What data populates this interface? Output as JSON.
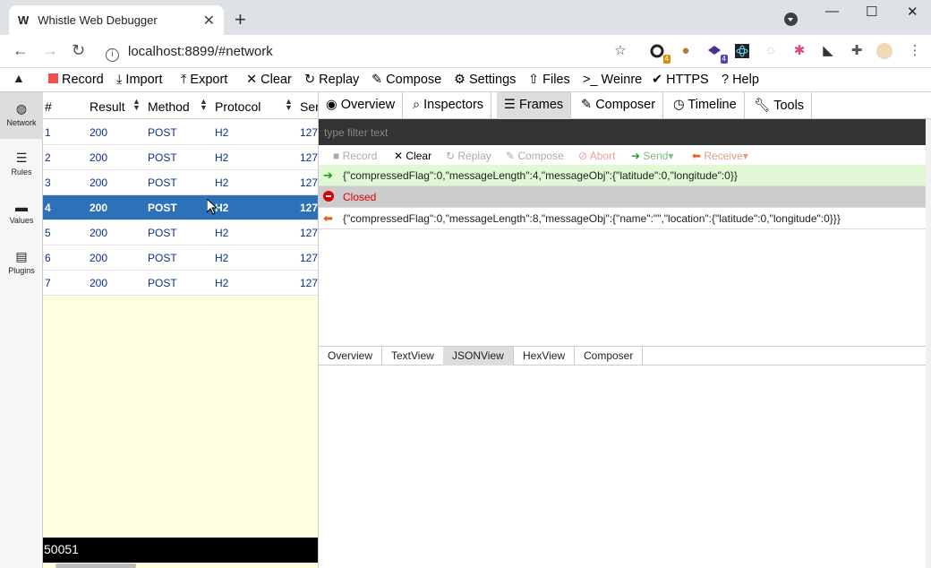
{
  "browser": {
    "tab_title": "Whistle Web Debugger",
    "favicon": "W",
    "close_glyph": "✕",
    "new_tab_glyph": "+",
    "url": "localhost:8899/#network",
    "ext_badges": [
      "4",
      "4"
    ]
  },
  "menu": {
    "record": "Record",
    "import": "Import",
    "export": "Export",
    "clear": "Clear",
    "replay": "Replay",
    "compose": "Compose",
    "settings": "Settings",
    "files": "Files",
    "weinre": "Weinre",
    "https": "HTTPS",
    "help": "Help"
  },
  "sidebar": {
    "items": [
      {
        "label": "Network",
        "icon": "globe-icon"
      },
      {
        "label": "Rules",
        "icon": "list-icon"
      },
      {
        "label": "Values",
        "icon": "folder-icon"
      },
      {
        "label": "Plugins",
        "icon": "plugin-icon"
      }
    ]
  },
  "network": {
    "columns": [
      "#",
      "Result",
      "Method",
      "Protocol",
      "Ser"
    ],
    "rows": [
      {
        "num": "1",
        "result": "200",
        "method": "POST",
        "protocol": "H2",
        "server": "127"
      },
      {
        "num": "2",
        "result": "200",
        "method": "POST",
        "protocol": "H2",
        "server": "127"
      },
      {
        "num": "3",
        "result": "200",
        "method": "POST",
        "protocol": "H2",
        "server": "127"
      },
      {
        "num": "4",
        "result": "200",
        "method": "POST",
        "protocol": "H2",
        "server": "127"
      },
      {
        "num": "5",
        "result": "200",
        "method": "POST",
        "protocol": "H2",
        "server": "127"
      },
      {
        "num": "6",
        "result": "200",
        "method": "POST",
        "protocol": "H2",
        "server": "127"
      },
      {
        "num": "7",
        "result": "200",
        "method": "POST",
        "protocol": "H2",
        "server": "127"
      }
    ],
    "selected_row": "4",
    "status_text": "50051"
  },
  "detail": {
    "tabs": [
      "Overview",
      "Inspectors",
      "Frames",
      "Composer",
      "Timeline",
      "Tools"
    ],
    "active_tab": "Frames",
    "filter_placeholder": "type filter text",
    "frame_toolbar": {
      "record": "Record",
      "clear": "Clear",
      "replay": "Replay",
      "compose": "Compose",
      "abort": "Abort",
      "send": "Send",
      "receive": "Receive"
    },
    "frames": [
      {
        "direction": "send",
        "text": "{\"compressedFlag\":0,\"messageLength\":4,\"messageObj\":{\"latitude\":0,\"longitude\":0}}"
      },
      {
        "direction": "closed",
        "text": "Closed"
      },
      {
        "direction": "receive",
        "text": "{\"compressedFlag\":0,\"messageLength\":8,\"messageObj\":{\"name\":\"\",\"location\":{\"latitude\":0,\"longitude\":0}}}"
      }
    ],
    "subtabs": [
      "Overview",
      "TextView",
      "JSONView",
      "HexView",
      "Composer"
    ],
    "active_subtab": "JSONView"
  },
  "colors": {
    "selected_row": "#2d72b8",
    "list_bg": "#ffffe0",
    "send_frame_bg": "#e0f9d4",
    "send_arrow": "#1a9a1a",
    "receive_arrow": "#e8601c",
    "closed_text": "#dd0000",
    "record_red": "#f05050"
  }
}
